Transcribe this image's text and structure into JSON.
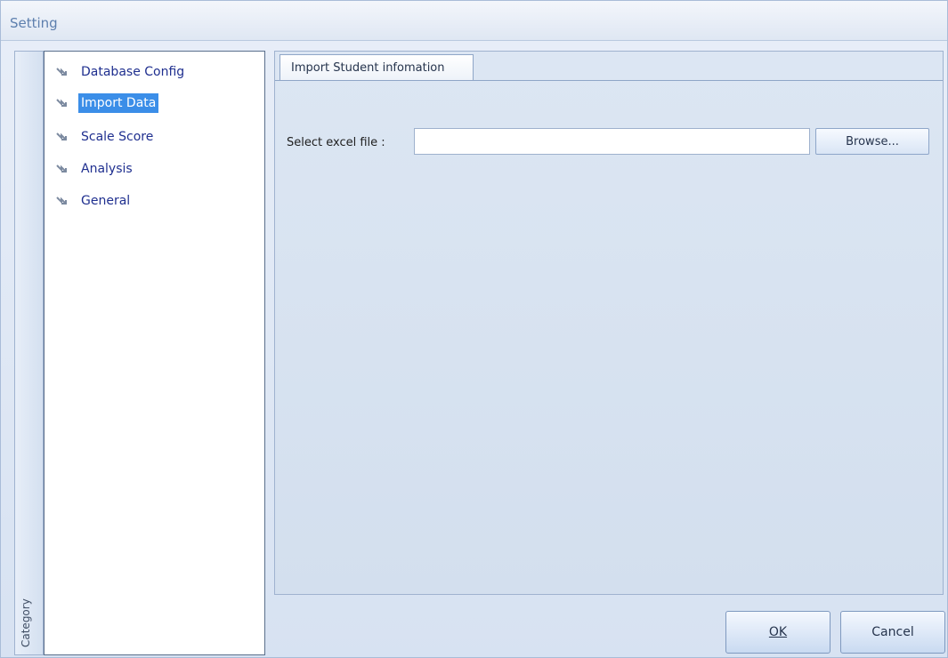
{
  "window": {
    "title": "Setting"
  },
  "sidebar": {
    "category_label": "Category",
    "items": [
      {
        "label": "Database Config",
        "icon": "arrow-icon",
        "selected": false
      },
      {
        "label": "Import Data",
        "icon": "arrow-icon",
        "selected": true
      },
      {
        "label": "Scale Score",
        "icon": "arrow-icon",
        "selected": false
      },
      {
        "label": "Analysis",
        "icon": "arrow-icon",
        "selected": false
      },
      {
        "label": "General",
        "icon": "arrow-icon",
        "selected": false
      }
    ]
  },
  "main": {
    "tab_label": "Import Student infomation",
    "field_label": "Select excel file :",
    "file_value": "",
    "browse_label": "Browse..."
  },
  "footer": {
    "ok_label": "OK",
    "cancel_label": "Cancel"
  },
  "colors": {
    "selection": "#3b8ee8",
    "tree_text": "#1f2f8f"
  }
}
